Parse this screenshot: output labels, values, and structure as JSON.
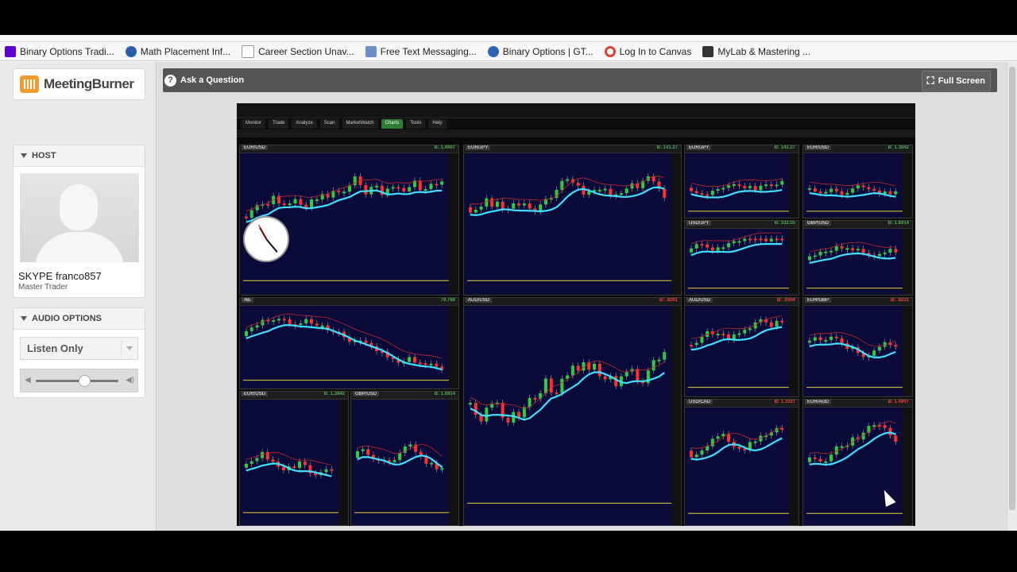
{
  "bookmarks": [
    {
      "label": "Binary Options Tradi...",
      "icon": "yahoo-icon",
      "color": "#5f01d1"
    },
    {
      "label": "Math Placement Inf...",
      "icon": "paw-icon",
      "color": "#2b5ea8"
    },
    {
      "label": "Career Section Unav...",
      "icon": "page-icon",
      "color": "#999999"
    },
    {
      "label": "Free Text Messaging...",
      "icon": "site-icon",
      "color": "#6b8fc7"
    },
    {
      "label": "Binary Options | GT...",
      "icon": "gear-icon",
      "color": "#2c66b8"
    },
    {
      "label": "Log In to Canvas",
      "icon": "canvas-icon",
      "color": "#e23c2e"
    },
    {
      "label": "MyLab & Mastering ...",
      "icon": "p-icon",
      "color": "#333333"
    }
  ],
  "brand": {
    "name": "MeetingBurner"
  },
  "host": {
    "header": "HOST",
    "name": "SKYPE franco857",
    "role": "Master Trader"
  },
  "audio": {
    "header": "AUDIO OPTIONS",
    "mode": "Listen Only",
    "volume_percent": 58
  },
  "toolbar": {
    "ask_label": "Ask a Question",
    "fullscreen_label": "Full Screen"
  },
  "tos": {
    "tabs": [
      "Monitor",
      "Trade",
      "Analyze",
      "Scan",
      "MarketWatch",
      "Charts",
      "Tools",
      "Help"
    ],
    "active_tab": "Charts"
  },
  "charts": [
    {
      "symbol": "EUR/USD",
      "bid": "B: 1.4907"
    },
    {
      "symbol": "EUR/JPY",
      "bid": "B: 141.27"
    },
    {
      "symbol": "EUR/JPY",
      "bid": "B: 141.27"
    },
    {
      "symbol": "EUR/USD",
      "bid": "B: 1.3842"
    },
    {
      "symbol": "USD/JPY",
      "bid": "B: 102.05"
    },
    {
      "symbol": "GBP/USD",
      "bid": "B: 1.6914"
    },
    {
      "symbol": "/6E",
      "bid": "79.768"
    },
    {
      "symbol": "AUD/USD",
      "bid": "B: .9201"
    },
    {
      "symbol": "AUD/USD",
      "bid": "B: .9304"
    },
    {
      "symbol": "EUR/GBP",
      "bid": "B: .8231"
    },
    {
      "symbol": "EUR/USD",
      "bid": "B: 1.3842"
    },
    {
      "symbol": "GBP/USD",
      "bid": "B: 1.6914"
    },
    {
      "symbol": "USD/CAD",
      "bid": "B: 1.1027"
    },
    {
      "symbol": "EUR/AUD",
      "bid": "B: 1.4907"
    }
  ]
}
